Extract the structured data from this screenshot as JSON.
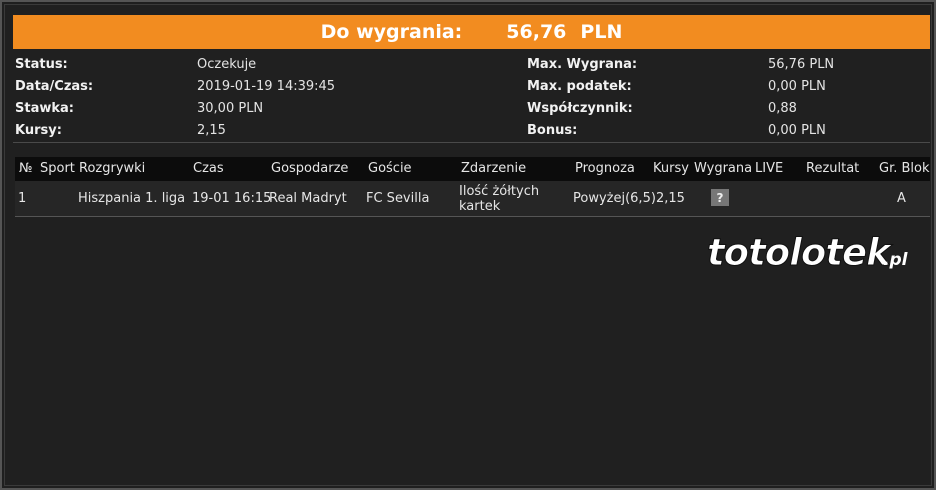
{
  "banner": {
    "label": "Do  wygrania:",
    "amount": "56,76",
    "currency": "PLN"
  },
  "summary": {
    "left": [
      {
        "key": "Status:",
        "value": "Oczekuje"
      },
      {
        "key": "Data/Czas:",
        "value": "2019-01-19 14:39:45"
      },
      {
        "key": "Stawka:",
        "value": "30,00 PLN"
      },
      {
        "key": "Kursy:",
        "value": "2,15"
      }
    ],
    "right": [
      {
        "key": "Max. Wygrana:",
        "value": "56,76 PLN"
      },
      {
        "key": "Max. podatek:",
        "value": "0,00 PLN"
      },
      {
        "key": "Współczynnik:",
        "value": "0,88"
      },
      {
        "key": "Bonus:",
        "value": "0,00 PLN"
      }
    ]
  },
  "table": {
    "headers": [
      "№",
      "Sport",
      "Rozgrywki",
      "Czas",
      "Gospodarze",
      "Goście",
      "Zdarzenie",
      "Prognoza",
      "Kursy",
      "Wygrana",
      "LIVE",
      "Rezultat",
      "Gr. Blok"
    ],
    "rows": [
      {
        "nr": "1",
        "sport": "",
        "competition": "Hiszpania 1. liga",
        "time": "19-01 16:15",
        "home": "Real Madryt",
        "away": "FC Sevilla",
        "event": "Ilość żółtych kartek",
        "prediction": "Powyżej(6,5)",
        "odds": "2,15",
        "win": "?",
        "live": "",
        "result": "",
        "group": "A"
      }
    ]
  },
  "logo": {
    "text": "totolotek",
    "suffix": ".pl"
  },
  "colors": {
    "accent": "#f28c20",
    "background": "#202020"
  }
}
